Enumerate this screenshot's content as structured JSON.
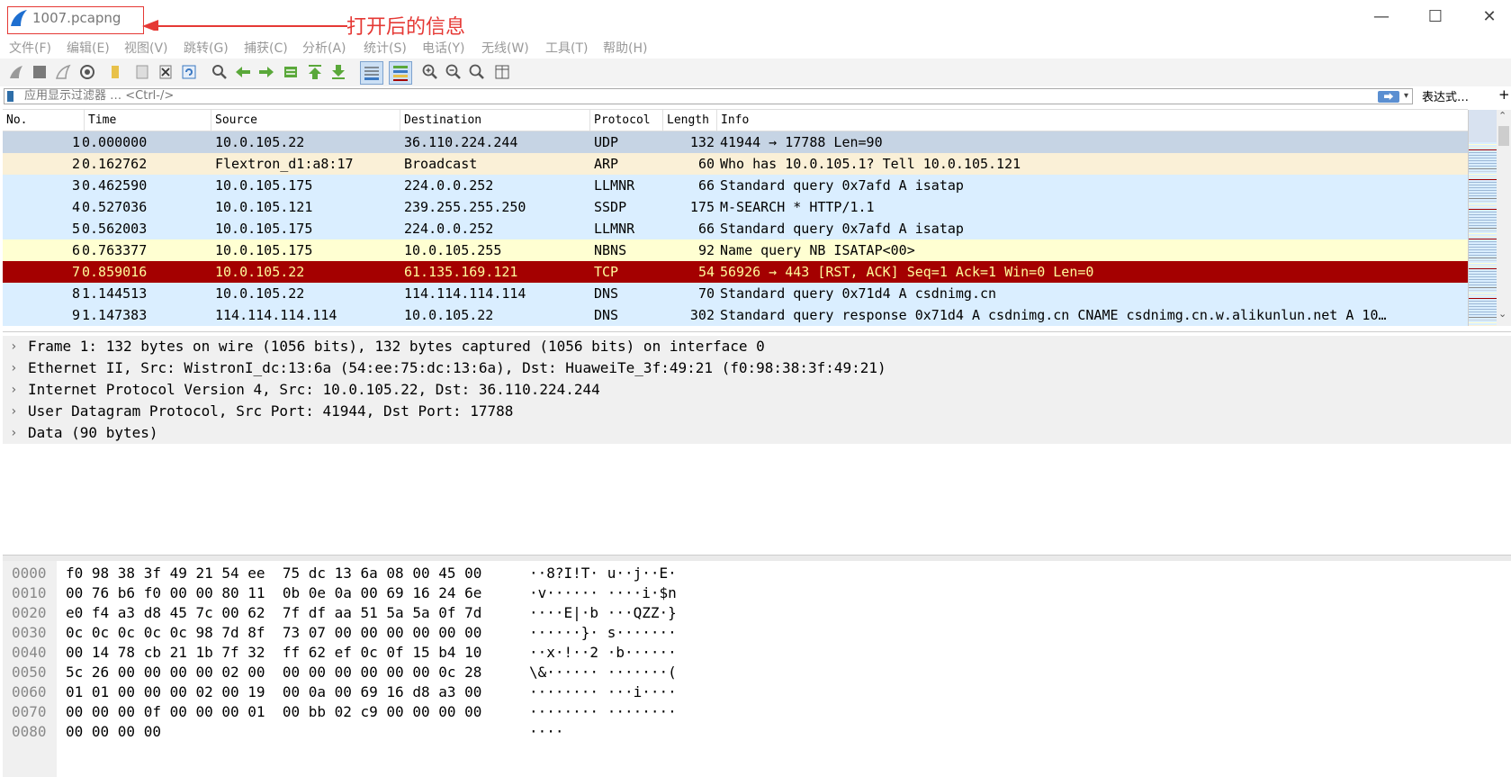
{
  "window": {
    "title": "1007.pcapng",
    "minimize": "—",
    "maximize": "☐",
    "close": "✕"
  },
  "annotation": {
    "text": "打开后的信息",
    "color": "#e53935"
  },
  "menu": [
    "文件(F)",
    "编辑(E)",
    "视图(V)",
    "跳转(G)",
    "捕获(C)",
    "分析(A)",
    "统计(S)",
    "电话(Y)",
    "无线(W)",
    "工具(T)",
    "帮助(H)"
  ],
  "toolbar": [
    "start-capture-icon",
    "stop-capture-icon",
    "restart-capture-icon",
    "capture-options-icon",
    "open-file-icon",
    "save-file-icon",
    "close-file-icon",
    "reload-file-icon",
    "find-packet-icon",
    "go-back-icon",
    "go-forward-icon",
    "go-to-packet-icon",
    "first-packet-icon",
    "last-packet-icon",
    "autoscroll-icon",
    "colorize-icon",
    "zoom-in-icon",
    "zoom-out-icon",
    "normal-size-icon",
    "resize-columns-icon"
  ],
  "filter": {
    "placeholder": "应用显示过滤器 … <Ctrl-/>",
    "apply": "⮕",
    "dropdown": "▾",
    "expression": "表达式…",
    "add": "+"
  },
  "columns": [
    "No.",
    "Time",
    "Source",
    "Destination",
    "Protocol",
    "Length",
    "Info"
  ],
  "packets": [
    {
      "no": "1",
      "time": "0.000000",
      "src": "10.0.105.22",
      "dst": "36.110.224.244",
      "proto": "UDP",
      "len": "132",
      "info": "41944 → 17788 Len=90",
      "bg": "#c6d4e4",
      "fg": "#000000"
    },
    {
      "no": "2",
      "time": "0.162762",
      "src": "Flextron_d1:a8:17",
      "dst": "Broadcast",
      "proto": "ARP",
      "len": "60",
      "info": "Who has 10.0.105.1? Tell 10.0.105.121",
      "bg": "#faf0d7",
      "fg": "#000000"
    },
    {
      "no": "3",
      "time": "0.462590",
      "src": "10.0.105.175",
      "dst": "224.0.0.252",
      "proto": "LLMNR",
      "len": "66",
      "info": "Standard query 0x7afd A isatap",
      "bg": "#daeeff",
      "fg": "#000000"
    },
    {
      "no": "4",
      "time": "0.527036",
      "src": "10.0.105.121",
      "dst": "239.255.255.250",
      "proto": "SSDP",
      "len": "175",
      "info": "M-SEARCH * HTTP/1.1",
      "bg": "#daeeff",
      "fg": "#000000"
    },
    {
      "no": "5",
      "time": "0.562003",
      "src": "10.0.105.175",
      "dst": "224.0.0.252",
      "proto": "LLMNR",
      "len": "66",
      "info": "Standard query 0x7afd A isatap",
      "bg": "#daeeff",
      "fg": "#000000"
    },
    {
      "no": "6",
      "time": "0.763377",
      "src": "10.0.105.175",
      "dst": "10.0.105.255",
      "proto": "NBNS",
      "len": "92",
      "info": "Name query NB ISATAP<00>",
      "bg": "#ffffd2",
      "fg": "#000000"
    },
    {
      "no": "7",
      "time": "0.859016",
      "src": "10.0.105.22",
      "dst": "61.135.169.121",
      "proto": "TCP",
      "len": "54",
      "info": "56926 → 443 [RST, ACK] Seq=1 Ack=1 Win=0 Len=0",
      "bg": "#a40000",
      "fg": "#fffc9c"
    },
    {
      "no": "8",
      "time": "1.144513",
      "src": "10.0.105.22",
      "dst": "114.114.114.114",
      "proto": "DNS",
      "len": "70",
      "info": "Standard query 0x71d4 A csdnimg.cn",
      "bg": "#daeeff",
      "fg": "#000000"
    },
    {
      "no": "9",
      "time": "1.147383",
      "src": "114.114.114.114",
      "dst": "10.0.105.22",
      "proto": "DNS",
      "len": "302",
      "info": "Standard query response 0x71d4 A csdnimg.cn CNAME csdnimg.cn.w.alikunlun.net A 10…",
      "bg": "#daeeff",
      "fg": "#000000"
    }
  ],
  "details": [
    "Frame 1: 132 bytes on wire (1056 bits), 132 bytes captured (1056 bits) on interface 0",
    "Ethernet II, Src: WistronI_dc:13:6a (54:ee:75:dc:13:6a), Dst: HuaweiTe_3f:49:21 (f0:98:38:3f:49:21)",
    "Internet Protocol Version 4, Src: 10.0.105.22, Dst: 36.110.224.244",
    "User Datagram Protocol, Src Port: 41944, Dst Port: 17788",
    "Data (90 bytes)"
  ],
  "bytes": [
    {
      "off": "0000",
      "hex": "f0 98 38 3f 49 21 54 ee  75 dc 13 6a 08 00 45 00",
      "ascii": "··8?I!T· u··j··E·"
    },
    {
      "off": "0010",
      "hex": "00 76 b6 f0 00 00 80 11  0b 0e 0a 00 69 16 24 6e",
      "ascii": "·v······ ····i·$n"
    },
    {
      "off": "0020",
      "hex": "e0 f4 a3 d8 45 7c 00 62  7f df aa 51 5a 5a 0f 7d",
      "ascii": "····E|·b ···QZZ·}"
    },
    {
      "off": "0030",
      "hex": "0c 0c 0c 0c 0c 98 7d 8f  73 07 00 00 00 00 00 00",
      "ascii": "······}· s·······"
    },
    {
      "off": "0040",
      "hex": "00 14 78 cb 21 1b 7f 32  ff 62 ef 0c 0f 15 b4 10",
      "ascii": "··x·!··2 ·b······"
    },
    {
      "off": "0050",
      "hex": "5c 26 00 00 00 00 02 00  00 00 00 00 00 00 0c 28",
      "ascii": "\\&······ ·······("
    },
    {
      "off": "0060",
      "hex": "01 01 00 00 00 02 00 19  00 0a 00 69 16 d8 a3 00",
      "ascii": "········ ···i····"
    },
    {
      "off": "0070",
      "hex": "00 00 00 0f 00 00 00 01  00 bb 02 c9 00 00 00 00",
      "ascii": "········ ········"
    },
    {
      "off": "0080",
      "hex": "00 00 00 00",
      "ascii": "····"
    }
  ]
}
